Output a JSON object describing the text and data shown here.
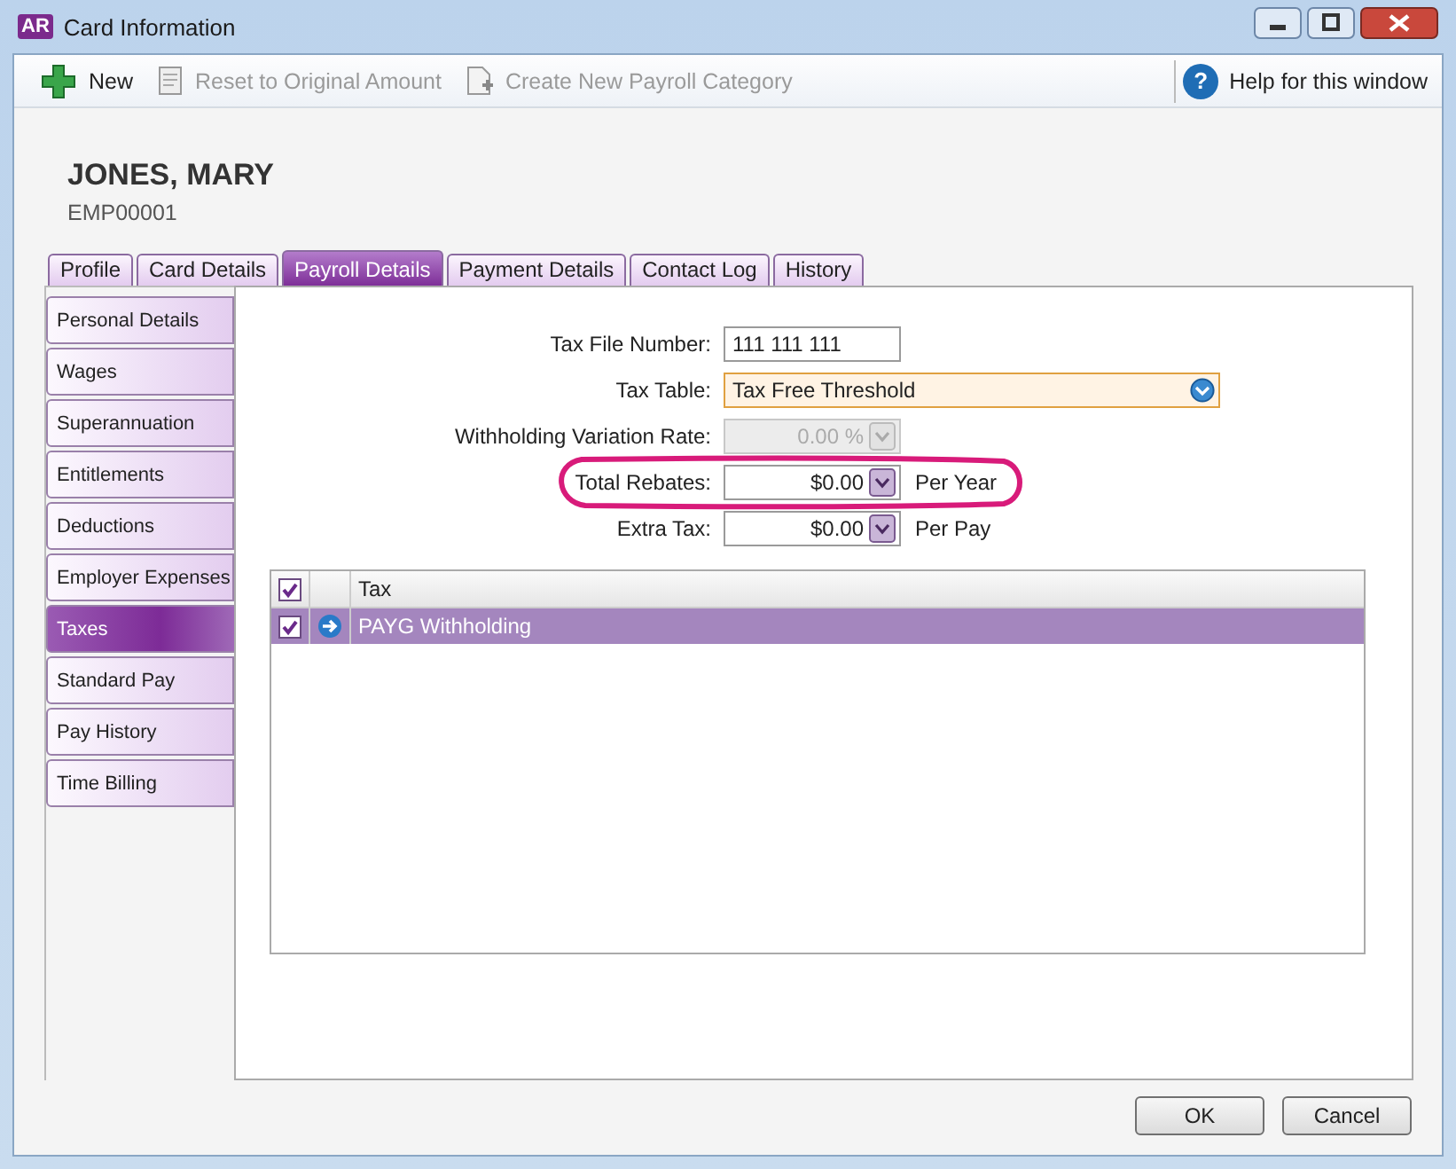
{
  "window": {
    "app_badge": "AR",
    "title": "Card Information"
  },
  "toolbar": {
    "items": [
      {
        "kind": "new",
        "label": "New",
        "disabled": false
      },
      {
        "kind": "reset",
        "label": "Reset to Original Amount",
        "disabled": true
      },
      {
        "kind": "create",
        "label": "Create New Payroll Category",
        "disabled": true
      }
    ],
    "help": {
      "icon": "?",
      "label": "Help for this window"
    }
  },
  "card": {
    "name": "JONES, MARY",
    "id": "EMP00001"
  },
  "tabs": [
    {
      "label": "Profile",
      "selected": false
    },
    {
      "label": "Card Details",
      "selected": false
    },
    {
      "label": "Payroll Details",
      "selected": true
    },
    {
      "label": "Payment Details",
      "selected": false
    },
    {
      "label": "Contact Log",
      "selected": false
    },
    {
      "label": "History",
      "selected": false
    }
  ],
  "side_tabs": [
    {
      "label": "Personal Details",
      "selected": false
    },
    {
      "label": "Wages",
      "selected": false
    },
    {
      "label": "Superannuation",
      "selected": false
    },
    {
      "label": "Entitlements",
      "selected": false
    },
    {
      "label": "Deductions",
      "selected": false
    },
    {
      "label": "Employer Expenses",
      "selected": false
    },
    {
      "label": "Taxes",
      "selected": true
    },
    {
      "label": "Standard Pay",
      "selected": false
    },
    {
      "label": "Pay History",
      "selected": false
    },
    {
      "label": "Time Billing",
      "selected": false
    }
  ],
  "form": {
    "fields": [
      {
        "kind": "text",
        "label": "Tax File Number:",
        "value": "111 111 111",
        "disabled": false
      },
      {
        "kind": "select",
        "label": "Tax Table:",
        "value": "Tax Free Threshold",
        "disabled": false
      },
      {
        "kind": "amount",
        "label": "Withholding Variation Rate:",
        "value": "0.00 %",
        "disabled": true
      },
      {
        "kind": "amount",
        "label": "Total Rebates:",
        "value": "$0.00",
        "suffix": "Per Year",
        "disabled": false
      },
      {
        "kind": "amount",
        "label": "Extra Tax:",
        "value": "$0.00",
        "suffix": "Per Pay",
        "disabled": false
      }
    ]
  },
  "table": {
    "columns": [
      "Tax"
    ],
    "all_checked": true,
    "rows": [
      {
        "checked": true,
        "selected": true,
        "tax": "PAYG Withholding"
      }
    ]
  },
  "buttons": [
    "OK",
    "Cancel"
  ]
}
